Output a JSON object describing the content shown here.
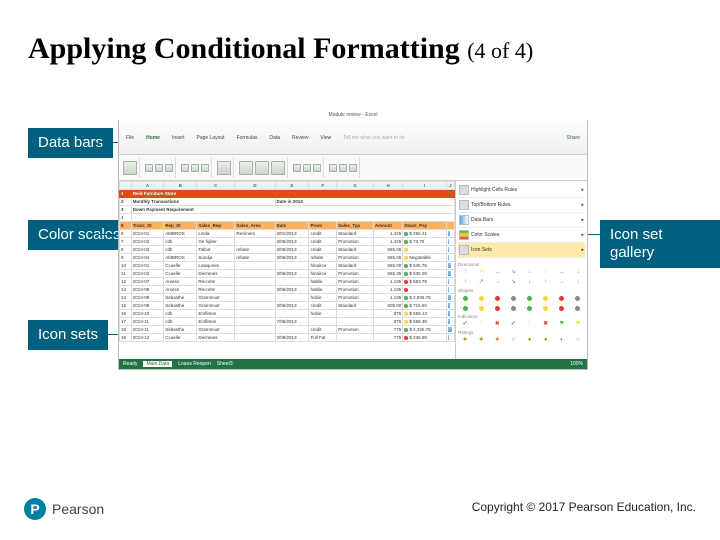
{
  "slide": {
    "title_main": "Applying Conditional Formatting",
    "title_sub": "(4 of 4)"
  },
  "callouts": {
    "data_bars": "Data bars",
    "color_scales": "Color scales",
    "icon_sets": "Icon sets",
    "icon_gallery": "Icon set gallery"
  },
  "excel": {
    "window_title": "Module review - Excel",
    "ribbon_tabs": [
      "File",
      "Home",
      "Insert",
      "Page Layout",
      "Formulas",
      "Data",
      "Review",
      "View",
      "Tell me what you want to do"
    ],
    "active_tab": "Home",
    "store_title": "Reid Furniture Store",
    "subtitle1": "Monthly Transactions",
    "subtitle2": "Date in 2013",
    "down_payment": "Down Payment Requirement",
    "share": "Share",
    "columns": [
      "A",
      "B",
      "C",
      "D",
      "E",
      "F",
      "G",
      "H",
      "I",
      "J",
      "K"
    ],
    "headers": [
      "Trans_ID",
      "Rep_ID",
      "Sales_Rep",
      "Sales_Area",
      "Date",
      "Prom",
      "Sales_Typ",
      "Amount",
      "Down_Pay"
    ],
    "rows": [
      {
        "id": "2013-01",
        "rep": "AMBROS",
        "name": "Linda",
        "area": "Recliners",
        "date": "3/01/2013",
        "prom": "credit",
        "type": "Standard",
        "amt": "1,425",
        "dp": "$ 256.21",
        "ic": "g",
        "bar": 40
      },
      {
        "id": "2013-02",
        "rep": "cdb",
        "name": "Ge fujiter",
        "area": "",
        "date": "3/05/2013",
        "prom": "credit",
        "type": "Promotion",
        "amt": "1,425",
        "dp": "$ 73.75",
        "ic": "g",
        "bar": 20
      },
      {
        "id": "2013-03",
        "rep": "cdb",
        "name": "Talbot",
        "area": "rebate",
        "date": "3/06/2013",
        "prom": "credit",
        "type": "Standard",
        "amt": "565.06",
        "dp": "",
        "ic": "y",
        "bar": 15
      },
      {
        "id": "2013-04",
        "rep": "AMBROS",
        "name": "Sundja",
        "area": "rebate",
        "date": "3/06/2013",
        "prom": "rebate",
        "type": "Promotion",
        "amt": "565.06",
        "dp": "Negotiable",
        "ic": "y",
        "bar": 25
      },
      {
        "id": "2013-01",
        "rep": "Ccuelle",
        "name": "Lowqunes",
        "area": "",
        "date": "",
        "prom": "hinairce",
        "type": "Standard",
        "amt": "565.00",
        "dp": "$ 545.75",
        "ic": "g",
        "bar": 60
      },
      {
        "id": "2013-02",
        "rep": "Ccuelle",
        "name": "Decranes",
        "area": "",
        "date": "3/06/2013",
        "prom": "hinairce",
        "type": "Promotion",
        "amt": "565.35",
        "dp": "$ 535.00",
        "ic": "g",
        "bar": 55
      },
      {
        "id": "2013-07",
        "rep": "Arvesn",
        "name": "Recorite",
        "area": "",
        "date": "",
        "prom": "hablie",
        "type": "Promotion",
        "amt": "1,135",
        "dp": "$ 583.79",
        "ic": "r",
        "bar": 30
      },
      {
        "id": "2013-08",
        "rep": "Arvesn",
        "name": "Recorite",
        "area": "",
        "date": "3/06/2013",
        "prom": "hablie",
        "type": "Promotion",
        "amt": "1,135",
        "dp": "",
        "ic": "r",
        "bar": 30
      },
      {
        "id": "2013-09",
        "rep": "Sebasthe",
        "name": "Grammuat",
        "area": "",
        "date": "",
        "prom": "hubie",
        "type": "Promotion",
        "amt": "1,135",
        "dp": "$ 2,935.75",
        "ic": "g",
        "bar": 70
      },
      {
        "id": "2013-08",
        "rep": "Sebasthe",
        "name": "Grammuat",
        "area": "",
        "date": "3/06/2013",
        "prom": "credit",
        "type": "Standard",
        "amt": "605.00",
        "dp": "$ 715.60",
        "ic": "g",
        "bar": 45
      },
      {
        "id": "2013-10",
        "rep": "cdb",
        "name": "Emfleton",
        "area": "",
        "date": "",
        "prom": "hubie",
        "type": "",
        "amt": "875",
        "dp": "$ 558.13",
        "ic": "y",
        "bar": 35
      },
      {
        "id": "2013-11",
        "rep": "cdb",
        "name": "Emfleton",
        "area": "",
        "date": "7/05/2013",
        "prom": "",
        "type": "",
        "amt": "875",
        "dp": "$ 558.38",
        "ic": "y",
        "bar": 35
      },
      {
        "id": "2013-11",
        "rep": "Sebasthe",
        "name": "Grammuat",
        "area": "",
        "date": "",
        "prom": "credit",
        "type": "Promotion",
        "amt": "775",
        "dp": "$ 4,325.75",
        "ic": "g",
        "bar": 80
      },
      {
        "id": "2013-12",
        "rep": "Ccuelle",
        "name": "Decranes",
        "area": "",
        "date": "3/09/2013",
        "prom": "Full Fat",
        "type": "",
        "amt": "775",
        "dp": "$ 236.88",
        "ic": "r",
        "bar": 25
      }
    ],
    "side_menu": {
      "highlight": "Highlight Cells Rules",
      "toptbottom": "Top/Bottom Rules",
      "databars": "Data Bars",
      "colorscales": "Color Scales",
      "iconsets": "Icon Sets"
    },
    "gallery_sections": {
      "directional": "Directional",
      "shapes": "Shapes",
      "indicators": "Indicators",
      "ratings": "Ratings"
    },
    "sheet_tabs": [
      "Main Data",
      "Loans Reopen",
      "Sheet3"
    ],
    "status_ready": "Ready",
    "status_right": "100%"
  },
  "footer": {
    "brand": "Pearson",
    "brand_letter": "P",
    "copyright": "Copyright © 2017 Pearson Education, Inc."
  }
}
